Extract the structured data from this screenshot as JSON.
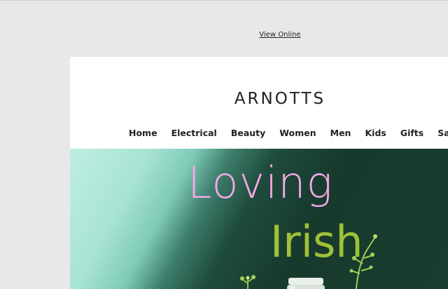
{
  "header": {
    "view_online": "View Online"
  },
  "brand": {
    "logo_text": "ARNOTTS"
  },
  "nav": {
    "items": [
      "Home",
      "Electrical",
      "Beauty",
      "Women",
      "Men",
      "Kids",
      "Gifts",
      "Sale"
    ]
  },
  "hero": {
    "line1": "Loving",
    "line2": "Irish"
  },
  "colors": {
    "loving": "#f3a9e4",
    "irish": "#9ec236",
    "hero_dark": "#173a2d",
    "hero_light": "#bfeee3"
  }
}
